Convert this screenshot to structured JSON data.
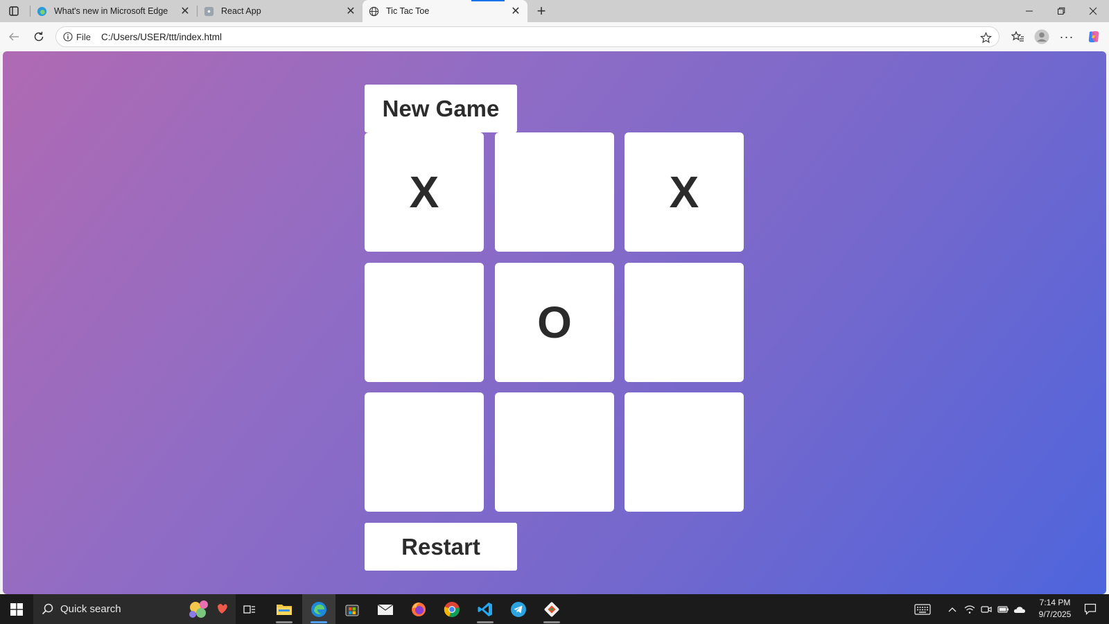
{
  "browser": {
    "tabs": [
      {
        "title": "What's new in Microsoft Edge",
        "favicon": "edge-icon",
        "active": false
      },
      {
        "title": "React App",
        "favicon": "react-icon",
        "active": false
      },
      {
        "title": "Tic Tac Toe",
        "favicon": "globe-icon",
        "active": true
      }
    ],
    "address": {
      "scheme_label": "File",
      "url": "C:/Users/USER/ttt/index.html"
    }
  },
  "game": {
    "new_game_label": "New Game",
    "restart_label": "Restart",
    "board": [
      "X",
      "",
      "X",
      "",
      "O",
      "",
      "",
      "",
      ""
    ]
  },
  "taskbar": {
    "search_placeholder": "Quick search",
    "time": "7:14 PM",
    "date": "9/7/2025"
  },
  "colors": {
    "gradient_start": "#b06ab3",
    "gradient_end": "#4e65dc",
    "mark_color": "#2b2b2b",
    "tabstrip_bg": "#cfcfcf",
    "taskbar_bg": "#1b1b1b"
  }
}
